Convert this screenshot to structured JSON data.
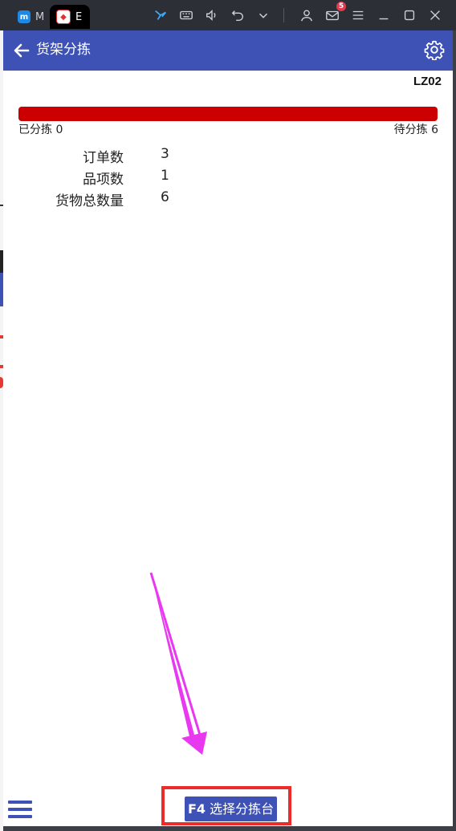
{
  "window": {
    "tabs": [
      {
        "label": "M",
        "icon": "app-blue-icon"
      },
      {
        "label": "E",
        "icon": "app-red-icon"
      }
    ],
    "notification_count": "5"
  },
  "appbar": {
    "title": "货架分拣",
    "back_icon": "arrow-left-icon",
    "settings_icon": "gear-icon"
  },
  "shelf_code": "LZ02",
  "progress": {
    "sorted_label": "已分拣 0",
    "pending_label": "待分拣 6",
    "sorted": 0,
    "total": 6,
    "color_done": "#3e51b5",
    "color_pending": "#cc0000"
  },
  "stats": [
    {
      "label": "订单数",
      "value": "3"
    },
    {
      "label": "品项数",
      "value": "1"
    },
    {
      "label": "货物总数量",
      "value": "6"
    }
  ],
  "action": {
    "key": "F4",
    "label": "选择分拣台"
  },
  "colors": {
    "primary": "#3e51b5",
    "annotation_box": "#ee2b2b",
    "annotation_arrow": "#e838f0"
  }
}
